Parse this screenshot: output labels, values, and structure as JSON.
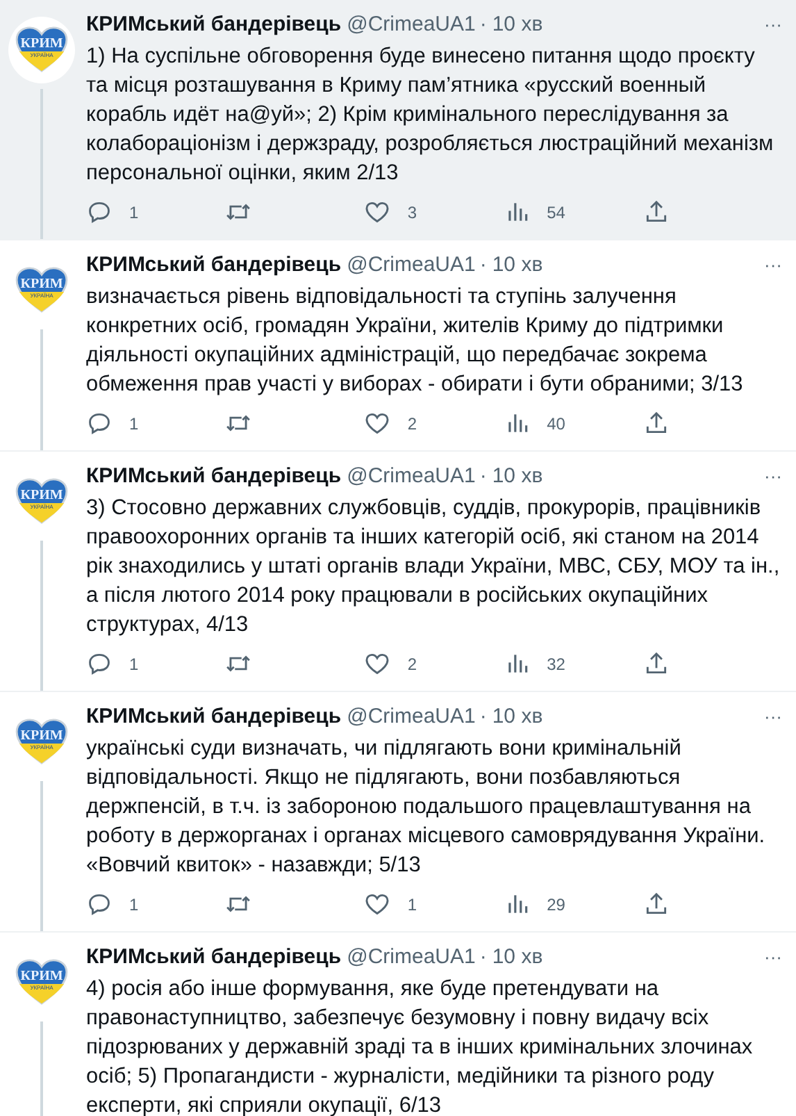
{
  "tweets": [
    {
      "hovered": true,
      "avatar": {
        "title": "КРИМ",
        "subtitle": "УКРАЇНА"
      },
      "name": "КРИМський бандерівець",
      "handle": "@CrimeaUA1",
      "dot": "·",
      "time": "10 хв",
      "more": "···",
      "text": "1) На суспільне обговорення буде винесено питання щодо проєкту та місця розташування в Криму пам’ятника «русский военный корабль идёт на@уй»; 2) Крім кримінального переслідування за колабораціонізм і держзраду, розробляється люстраційний механізм персональної оцінки, яким 2/13",
      "stats": {
        "replies": "1",
        "likes": "3",
        "views": "54"
      }
    },
    {
      "hovered": false,
      "avatar": {
        "title": "КРИМ",
        "subtitle": "УКРАЇНА"
      },
      "name": "КРИМський бандерівець",
      "handle": "@CrimeaUA1",
      "dot": "·",
      "time": "10 хв",
      "more": "···",
      "text": "визначається рівень відповідальності та ступінь залучення конкретних осіб, громадян України, жителів Криму до підтримки діяльності окупаційних адміністрацій, що передбачає зокрема обмеження прав участі у виборах - обирати і бути обраними; 3/13",
      "stats": {
        "replies": "1",
        "likes": "2",
        "views": "40"
      }
    },
    {
      "hovered": false,
      "avatar": {
        "title": "КРИМ",
        "subtitle": "УКРАЇНА"
      },
      "name": "КРИМський бандерівець",
      "handle": "@CrimeaUA1",
      "dot": "·",
      "time": "10 хв",
      "more": "···",
      "text": "3) Стосовно державних службовців, суддів, прокурорів, працівників правоохоронних органів та інших категорій осіб, які станом на 2014 рік знаходились у штаті органів влади України, МВС, СБУ, МОУ та ін., а після лютого 2014 року працювали в російських окупаційних структурах, 4/13",
      "stats": {
        "replies": "1",
        "likes": "2",
        "views": "32"
      }
    },
    {
      "hovered": false,
      "avatar": {
        "title": "КРИМ",
        "subtitle": "УКРАЇНА"
      },
      "name": "КРИМський бандерівець",
      "handle": "@CrimeaUA1",
      "dot": "·",
      "time": "10 хв",
      "more": "···",
      "text": "українські суди визначать, чи підлягають вони кримінальній відповідальності. Якщо не підлягають, вони позбавляються держпенсій, в т.ч. із забороною подальшого працевлаштування на роботу в держорганах і органах місцевого самоврядування України. «Вовчий квиток» - назавжди; 5/13",
      "stats": {
        "replies": "1",
        "likes": "1",
        "views": "29"
      }
    },
    {
      "hovered": false,
      "avatar": {
        "title": "КРИМ",
        "subtitle": "УКРАЇНА"
      },
      "name": "КРИМський бандерівець",
      "handle": "@CrimeaUA1",
      "dot": "·",
      "time": "10 хв",
      "more": "···",
      "text": "4) росія або інше формування, яке буде претендувати на правонаступництво, забезпечує безумовну і повну видачу всіх підозрюваних у державній зраді та в інших кримінальних злочинах осіб; 5) Пропагандисти - журналісти, медійники та різного роду експерти, які сприяли окупації, 6/13"
    }
  ]
}
